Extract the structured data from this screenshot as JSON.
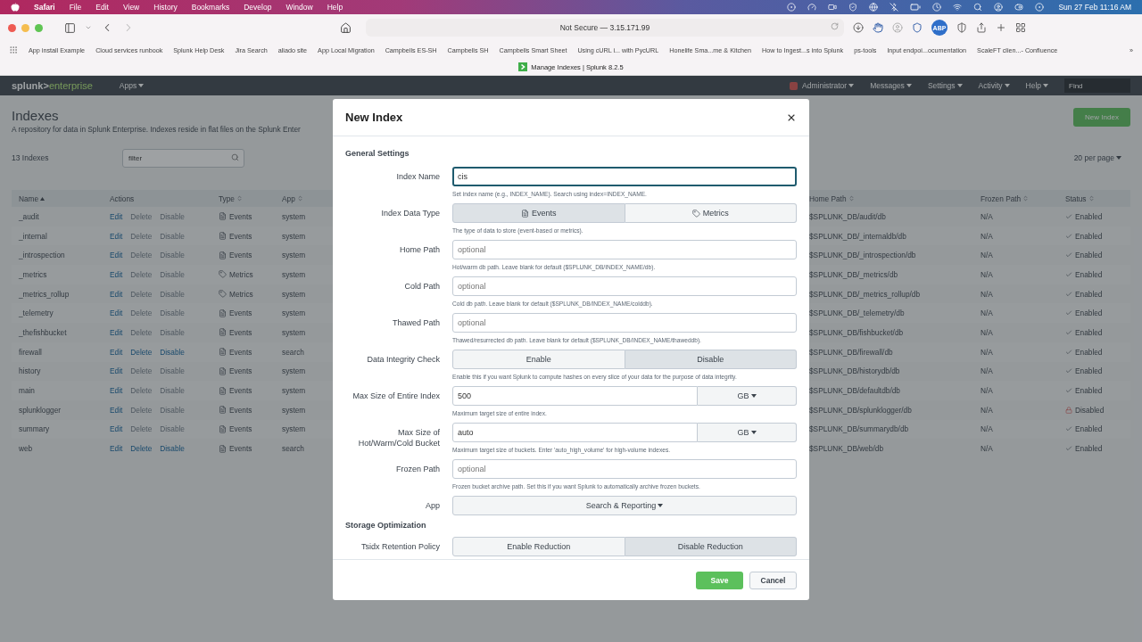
{
  "menubar": {
    "app_name": "Safari",
    "menus": [
      "File",
      "Edit",
      "View",
      "History",
      "Bookmarks",
      "Develop",
      "Window",
      "Help"
    ],
    "clock": "Sun 27 Feb  11:16 AM"
  },
  "browser": {
    "address": "Not Secure — 3.15.171.99",
    "forward_disabled": true,
    "adblock_label": "ABP",
    "bookmarks": [
      "App install Example",
      "Cloud services runbook",
      "Splunk Help Desk",
      "Jira Search",
      "aliado site",
      "App Local Migration",
      "Campbells ES-SH",
      "Campbells SH",
      "Campbells Smart Sheet",
      "Using cURL i... with PycURL",
      "Honelife Sma...me & Kitchen",
      "How to Ingest...s into Splunk",
      "ps-tools",
      "Input endpoi...ocumentation",
      "ScaleFT clien...- Confluence"
    ],
    "more_bookmarks": "»",
    "tab_title": "Manage Indexes | Splunk 8.2.5"
  },
  "splunk": {
    "brand": "splunk>",
    "product": "enterprise",
    "apps_menu": "Apps",
    "nav": [
      "Administrator",
      "Messages",
      "Settings",
      "Activity",
      "Help"
    ],
    "find_placeholder": "Find",
    "page": {
      "title": "Indexes",
      "description": "A repository for data in Splunk Enterprise. Indexes reside in flat files on the Splunk Enter",
      "new_button": "New Index",
      "count": "13 Indexes",
      "filter_placeholder": "filter",
      "per_page": "20 per page"
    },
    "table": {
      "columns": [
        {
          "label": "Name",
          "kind": "sorted"
        },
        {
          "label": "Actions",
          "kind": "plain"
        },
        {
          "label": "Type",
          "kind": "sortable"
        },
        {
          "label": "App",
          "kind": "sortable"
        },
        {
          "label": "Home Path",
          "kind": "sortable"
        },
        {
          "label": "Frozen Path",
          "kind": "sortable"
        },
        {
          "label": "Status",
          "kind": "sortable"
        }
      ],
      "rows": [
        {
          "name": "_audit",
          "actions": [
            {
              "label": "Edit",
              "disabled": false
            },
            {
              "label": "Delete",
              "disabled": true
            },
            {
              "label": "Disable",
              "disabled": true
            }
          ],
          "type": {
            "label": "Events",
            "kind": "events"
          },
          "app": "system",
          "home_path": "$SPLUNK_DB/audit/db",
          "frozen_path": "N/A",
          "status": {
            "label": "Enabled",
            "kind": "enabled"
          }
        },
        {
          "name": "_internal",
          "actions": [
            {
              "label": "Edit",
              "disabled": false
            },
            {
              "label": "Delete",
              "disabled": true
            },
            {
              "label": "Disable",
              "disabled": true
            }
          ],
          "type": {
            "label": "Events",
            "kind": "events"
          },
          "app": "system",
          "home_path": "$SPLUNK_DB/_internaldb/db",
          "frozen_path": "N/A",
          "status": {
            "label": "Enabled",
            "kind": "enabled"
          }
        },
        {
          "name": "_introspection",
          "actions": [
            {
              "label": "Edit",
              "disabled": false
            },
            {
              "label": "Delete",
              "disabled": true
            },
            {
              "label": "Disable",
              "disabled": true
            }
          ],
          "type": {
            "label": "Events",
            "kind": "events"
          },
          "app": "system",
          "home_path": "$SPLUNK_DB/_introspection/db",
          "frozen_path": "N/A",
          "status": {
            "label": "Enabled",
            "kind": "enabled"
          }
        },
        {
          "name": "_metrics",
          "actions": [
            {
              "label": "Edit",
              "disabled": false
            },
            {
              "label": "Delete",
              "disabled": true
            },
            {
              "label": "Disable",
              "disabled": true
            }
          ],
          "type": {
            "label": "Metrics",
            "kind": "metrics"
          },
          "app": "system",
          "home_path": "$SPLUNK_DB/_metrics/db",
          "frozen_path": "N/A",
          "status": {
            "label": "Enabled",
            "kind": "enabled"
          }
        },
        {
          "name": "_metrics_rollup",
          "actions": [
            {
              "label": "Edit",
              "disabled": false
            },
            {
              "label": "Delete",
              "disabled": true
            },
            {
              "label": "Disable",
              "disabled": true
            }
          ],
          "type": {
            "label": "Metrics",
            "kind": "metrics"
          },
          "app": "system",
          "home_path": "$SPLUNK_DB/_metrics_rollup/db",
          "frozen_path": "N/A",
          "status": {
            "label": "Enabled",
            "kind": "enabled"
          }
        },
        {
          "name": "_telemetry",
          "actions": [
            {
              "label": "Edit",
              "disabled": false
            },
            {
              "label": "Delete",
              "disabled": true
            },
            {
              "label": "Disable",
              "disabled": true
            }
          ],
          "type": {
            "label": "Events",
            "kind": "events"
          },
          "app": "system",
          "home_path": "$SPLUNK_DB/_telemetry/db",
          "frozen_path": "N/A",
          "status": {
            "label": "Enabled",
            "kind": "enabled"
          }
        },
        {
          "name": "_thefishbucket",
          "actions": [
            {
              "label": "Edit",
              "disabled": false
            },
            {
              "label": "Delete",
              "disabled": true
            },
            {
              "label": "Disable",
              "disabled": true
            }
          ],
          "type": {
            "label": "Events",
            "kind": "events"
          },
          "app": "system",
          "home_path": "$SPLUNK_DB/fishbucket/db",
          "frozen_path": "N/A",
          "status": {
            "label": "Enabled",
            "kind": "enabled"
          }
        },
        {
          "name": "firewall",
          "actions": [
            {
              "label": "Edit",
              "disabled": false
            },
            {
              "label": "Delete",
              "disabled": false
            },
            {
              "label": "Disable",
              "disabled": false
            }
          ],
          "type": {
            "label": "Events",
            "kind": "events"
          },
          "app": "search",
          "home_path": "$SPLUNK_DB/firewall/db",
          "frozen_path": "N/A",
          "status": {
            "label": "Enabled",
            "kind": "enabled"
          }
        },
        {
          "name": "history",
          "actions": [
            {
              "label": "Edit",
              "disabled": false
            },
            {
              "label": "Delete",
              "disabled": true
            },
            {
              "label": "Disable",
              "disabled": true
            }
          ],
          "type": {
            "label": "Events",
            "kind": "events"
          },
          "app": "system",
          "home_path": "$SPLUNK_DB/historydb/db",
          "frozen_path": "N/A",
          "status": {
            "label": "Enabled",
            "kind": "enabled"
          }
        },
        {
          "name": "main",
          "actions": [
            {
              "label": "Edit",
              "disabled": false
            },
            {
              "label": "Delete",
              "disabled": true
            },
            {
              "label": "Disable",
              "disabled": true
            }
          ],
          "type": {
            "label": "Events",
            "kind": "events"
          },
          "app": "system",
          "home_path": "$SPLUNK_DB/defaultdb/db",
          "frozen_path": "N/A",
          "status": {
            "label": "Enabled",
            "kind": "enabled"
          }
        },
        {
          "name": "splunklogger",
          "actions": [
            {
              "label": "Edit",
              "disabled": false
            },
            {
              "label": "Delete",
              "disabled": true
            },
            {
              "label": "Disable",
              "disabled": true
            }
          ],
          "type": {
            "label": "Events",
            "kind": "events"
          },
          "app": "system",
          "home_path": "$SPLUNK_DB/splunklogger/db",
          "frozen_path": "N/A",
          "status": {
            "label": "Disabled",
            "kind": "disabled"
          }
        },
        {
          "name": "summary",
          "actions": [
            {
              "label": "Edit",
              "disabled": false
            },
            {
              "label": "Delete",
              "disabled": true
            },
            {
              "label": "Disable",
              "disabled": true
            }
          ],
          "type": {
            "label": "Events",
            "kind": "events"
          },
          "app": "system",
          "home_path": "$SPLUNK_DB/summarydb/db",
          "frozen_path": "N/A",
          "status": {
            "label": "Enabled",
            "kind": "enabled"
          }
        },
        {
          "name": "web",
          "actions": [
            {
              "label": "Edit",
              "disabled": false
            },
            {
              "label": "Delete",
              "disabled": false
            },
            {
              "label": "Disable",
              "disabled": false
            }
          ],
          "type": {
            "label": "Events",
            "kind": "events"
          },
          "app": "search",
          "home_path": "$SPLUNK_DB/web/db",
          "frozen_path": "N/A",
          "status": {
            "label": "Enabled",
            "kind": "enabled"
          }
        }
      ]
    }
  },
  "modal": {
    "title": "New Index",
    "sections": [
      {
        "heading": "General Settings",
        "fields": [
          {
            "kind": "text",
            "label": "Index Name",
            "value": "cis",
            "focused": true,
            "help": "Set index name (e.g., INDEX_NAME). Search using index=INDEX_NAME."
          },
          {
            "kind": "toggle",
            "label": "Index Data Type",
            "options": [
              {
                "label": "Events",
                "kind": "events",
                "selected": true
              },
              {
                "label": "Metrics",
                "kind": "metrics",
                "selected": false
              }
            ],
            "help": "The type of data to store (event-based or metrics)."
          },
          {
            "kind": "text",
            "label": "Home Path",
            "placeholder": "optional",
            "focused": false,
            "help": "Hot/warm db path. Leave blank for default ($SPLUNK_DB/INDEX_NAME/db)."
          },
          {
            "kind": "text",
            "label": "Cold Path",
            "placeholder": "optional",
            "focused": false,
            "help": "Cold db path. Leave blank for default ($SPLUNK_DB/INDEX_NAME/colddb)."
          },
          {
            "kind": "text",
            "label": "Thawed Path",
            "placeholder": "optional",
            "focused": false,
            "help": "Thawed/resurrected db path. Leave blank for default ($SPLUNK_DB/INDEX_NAME/thaweddb)."
          },
          {
            "kind": "toggle",
            "label": "Data Integrity Check",
            "options": [
              {
                "label": "Enable",
                "selected": false
              },
              {
                "label": "Disable",
                "selected": true
              }
            ],
            "help": "Enable this if you want Splunk to compute hashes on every slice of your data for the purpose of data integrity."
          },
          {
            "kind": "size",
            "label": "Max Size of Entire Index",
            "value": "500",
            "unit": "GB",
            "help": "Maximum target size of entire index."
          },
          {
            "kind": "size",
            "label": "Max Size of Hot/Warm/Cold Bucket",
            "value": "auto",
            "unit": "GB",
            "help": "Maximum target size of buckets. Enter 'auto_high_volume' for high-volume indexes."
          },
          {
            "kind": "text",
            "label": "Frozen Path",
            "placeholder": "optional",
            "focused": false,
            "help": "Frozen bucket archive path. Set this if you want Splunk to automatically archive frozen buckets."
          },
          {
            "kind": "select",
            "label": "App",
            "value": "Search & Reporting"
          }
        ]
      },
      {
        "heading": "Storage Optimization",
        "fields": [
          {
            "kind": "toggle",
            "label": "Tsidx Retention Policy",
            "options": [
              {
                "label": "Enable Reduction",
                "selected": false
              },
              {
                "label": "Disable Reduction",
                "selected": true
              }
            ]
          }
        ]
      }
    ],
    "buttons": [
      {
        "label": "Save",
        "kind": "primary"
      },
      {
        "label": "Cancel",
        "kind": "secondary"
      }
    ]
  }
}
